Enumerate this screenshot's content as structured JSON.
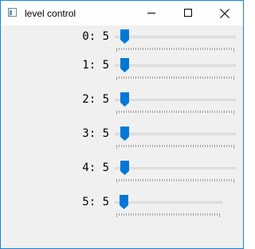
{
  "window": {
    "title": "level control",
    "icon": "app-window-icon",
    "controls": [
      "minimize-icon",
      "maximize-icon",
      "close-icon"
    ]
  },
  "colors": {
    "accent": "#0078d7",
    "track": "#e7e7e7",
    "tick": "#a0a0a0",
    "background": "#f0f0f0"
  },
  "sliders": [
    {
      "label": "0: 5",
      "value": 5
    },
    {
      "label": "1: 5",
      "value": 5
    },
    {
      "label": "2: 5",
      "value": 5
    },
    {
      "label": "3: 5",
      "value": 5
    },
    {
      "label": "4: 5",
      "value": 5
    },
    {
      "label": "5: 5",
      "value": 5
    }
  ]
}
